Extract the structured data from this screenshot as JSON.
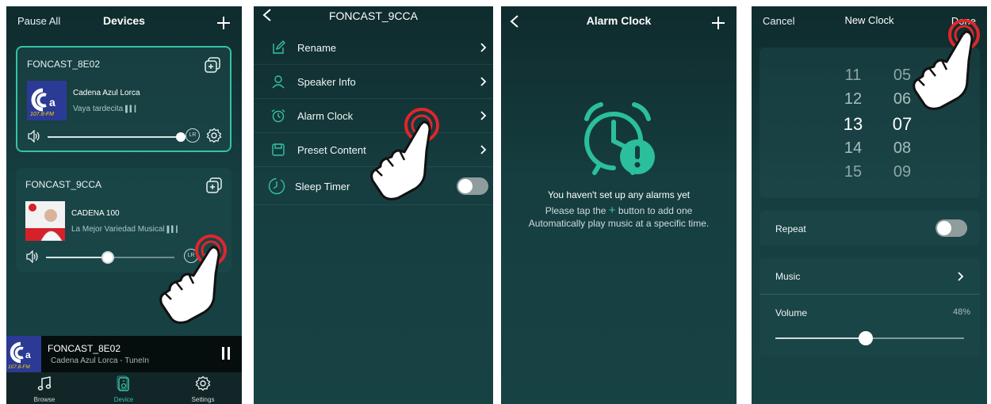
{
  "screen1": {
    "left_action": "Pause All",
    "title": "Devices",
    "add_icon": "plus-icon",
    "devices": [
      {
        "name": "FONCAST_8E02",
        "station": "Cadena Azul Lorca",
        "subtitle": "Vaya tardecita",
        "art_text": "107.8-FM",
        "volume": 1.0,
        "lr": "LR",
        "active": true
      },
      {
        "name": "FONCAST_9CCA",
        "station": "CADENA 100",
        "subtitle": "La Mejor Variedad Musical",
        "volume": 0.5,
        "lr": "LR",
        "active": false
      }
    ],
    "now_playing": {
      "title": "FONCAST_8E02",
      "subtitle": "Cadena Azul Lorca - TuneIn",
      "art_text": "107.8-FM"
    },
    "tabs": [
      {
        "label": "Browse",
        "icon": "music-note-icon"
      },
      {
        "label": "Device",
        "icon": "speaker-icon",
        "selected": true
      },
      {
        "label": "Settings",
        "icon": "gear-icon"
      }
    ]
  },
  "screen2": {
    "title": "FONCAST_9CCA",
    "menu": [
      {
        "label": "Rename",
        "icon": "edit-icon"
      },
      {
        "label": "Speaker Info",
        "icon": "person-icon"
      },
      {
        "label": "Alarm Clock",
        "icon": "alarm-icon"
      },
      {
        "label": "Preset Content",
        "icon": "preset-icon"
      }
    ],
    "sleep_timer": {
      "label": "Sleep Timer",
      "icon": "timer-icon",
      "enabled": false
    }
  },
  "screen3": {
    "title": "Alarm Clock",
    "empty_line1": "You haven't set up any alarms yet",
    "empty_line2_pre": "Please tap the",
    "empty_line2_post": "button to add one",
    "empty_line3": "Automatically play music at a specific time."
  },
  "screen4": {
    "cancel": "Cancel",
    "title": "New Clock",
    "done": "Done",
    "hours": [
      "11",
      "12",
      "13",
      "14",
      "15"
    ],
    "minutes": [
      "05",
      "06",
      "07",
      "08",
      "09"
    ],
    "selected_hour": "13",
    "selected_minute": "07",
    "repeat_label": "Repeat",
    "repeat_enabled": false,
    "music_label": "Music",
    "volume_label": "Volume",
    "volume_value": "48%",
    "volume_fraction": 0.48
  },
  "colors": {
    "accent": "#36c2a5",
    "tap_ring": "#e0262b",
    "background": "#163e40"
  }
}
